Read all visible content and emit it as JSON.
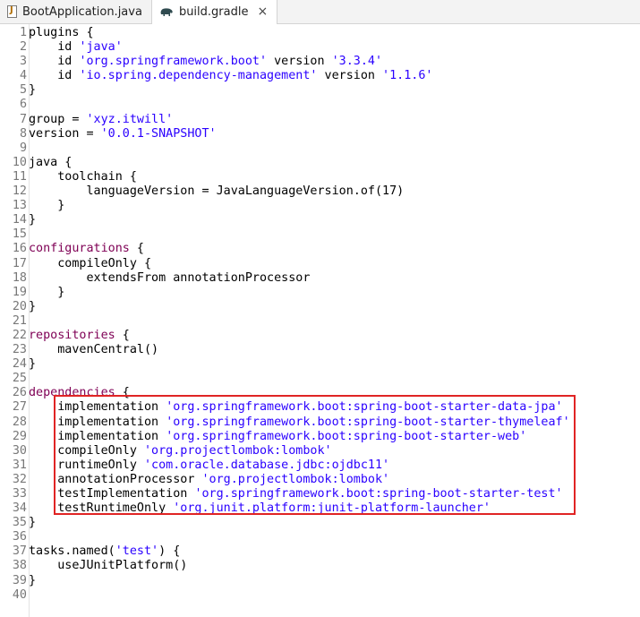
{
  "tabs": [
    {
      "label": "BootApplication.java",
      "icon": "java-file-icon",
      "active": false
    },
    {
      "label": "build.gradle",
      "icon": "gradle-elephant-icon",
      "active": true,
      "close": "×"
    }
  ],
  "lines": [
    {
      "n": "1",
      "segs": [
        {
          "t": "plugins {",
          "c": "kw-partial"
        }
      ]
    },
    {
      "n": "2",
      "segs": [
        {
          "t": "    id "
        },
        {
          "t": "'java'",
          "c": "str"
        }
      ]
    },
    {
      "n": "3",
      "segs": [
        {
          "t": "    id "
        },
        {
          "t": "'org.springframework.boot'",
          "c": "str"
        },
        {
          "t": " version "
        },
        {
          "t": "'3.3.4'",
          "c": "str"
        }
      ]
    },
    {
      "n": "4",
      "segs": [
        {
          "t": "    id "
        },
        {
          "t": "'io.spring.dependency-management'",
          "c": "str"
        },
        {
          "t": " version "
        },
        {
          "t": "'1.1.6'",
          "c": "str"
        }
      ]
    },
    {
      "n": "5",
      "segs": [
        {
          "t": "}"
        }
      ]
    },
    {
      "n": "6",
      "segs": []
    },
    {
      "n": "7",
      "segs": [
        {
          "t": "group = "
        },
        {
          "t": "'xyz.itwill'",
          "c": "str"
        }
      ]
    },
    {
      "n": "8",
      "segs": [
        {
          "t": "version = "
        },
        {
          "t": "'0.0.1-SNAPSHOT'",
          "c": "str"
        }
      ]
    },
    {
      "n": "9",
      "segs": []
    },
    {
      "n": "10",
      "segs": [
        {
          "t": "java {"
        }
      ]
    },
    {
      "n": "11",
      "segs": [
        {
          "t": "    toolchain {"
        }
      ]
    },
    {
      "n": "12",
      "segs": [
        {
          "t": "        languageVersion = JavaLanguageVersion.of(17)"
        }
      ]
    },
    {
      "n": "13",
      "segs": [
        {
          "t": "    }"
        }
      ]
    },
    {
      "n": "14",
      "segs": [
        {
          "t": "}"
        }
      ]
    },
    {
      "n": "15",
      "segs": []
    },
    {
      "n": "16",
      "segs": [
        {
          "t": "configurations",
          "c": "kw"
        },
        {
          "t": " {"
        }
      ]
    },
    {
      "n": "17",
      "segs": [
        {
          "t": "    compileOnly {"
        }
      ]
    },
    {
      "n": "18",
      "segs": [
        {
          "t": "        extendsFrom annotationProcessor"
        }
      ]
    },
    {
      "n": "19",
      "segs": [
        {
          "t": "    }"
        }
      ]
    },
    {
      "n": "20",
      "segs": [
        {
          "t": "}"
        }
      ]
    },
    {
      "n": "21",
      "segs": []
    },
    {
      "n": "22",
      "segs": [
        {
          "t": "repositories",
          "c": "kw"
        },
        {
          "t": " {"
        }
      ]
    },
    {
      "n": "23",
      "segs": [
        {
          "t": "    mavenCentral()"
        }
      ]
    },
    {
      "n": "24",
      "segs": [
        {
          "t": "}"
        }
      ]
    },
    {
      "n": "25",
      "segs": []
    },
    {
      "n": "26",
      "segs": [
        {
          "t": "dependencies",
          "c": "kw"
        },
        {
          "t": " {"
        }
      ]
    },
    {
      "n": "27",
      "segs": [
        {
          "t": "    implementation "
        },
        {
          "t": "'org.springframework.boot:spring-boot-starter-data-jpa'",
          "c": "str"
        }
      ]
    },
    {
      "n": "28",
      "segs": [
        {
          "t": "    implementation "
        },
        {
          "t": "'org.springframework.boot:spring-boot-starter-thymeleaf'",
          "c": "str"
        }
      ]
    },
    {
      "n": "29",
      "segs": [
        {
          "t": "    implementation "
        },
        {
          "t": "'org.springframework.boot:spring-boot-starter-web'",
          "c": "str"
        }
      ]
    },
    {
      "n": "30",
      "segs": [
        {
          "t": "    compileOnly "
        },
        {
          "t": "'org.projectlombok:lombok'",
          "c": "str"
        }
      ]
    },
    {
      "n": "31",
      "segs": [
        {
          "t": "    runtimeOnly "
        },
        {
          "t": "'com.oracle.database.jdbc:ojdbc11'",
          "c": "str"
        }
      ]
    },
    {
      "n": "32",
      "segs": [
        {
          "t": "    annotationProcessor "
        },
        {
          "t": "'org.projectlombok:lombok'",
          "c": "str"
        }
      ]
    },
    {
      "n": "33",
      "segs": [
        {
          "t": "    testImplementation "
        },
        {
          "t": "'org.springframework.boot:spring-boot-starter-test'",
          "c": "str"
        }
      ]
    },
    {
      "n": "34",
      "segs": [
        {
          "t": "    testRuntimeOnly "
        },
        {
          "t": "'org.junit.platform:junit-platform-launcher'",
          "c": "str"
        }
      ]
    },
    {
      "n": "35",
      "segs": [
        {
          "t": "}"
        }
      ]
    },
    {
      "n": "36",
      "segs": []
    },
    {
      "n": "37",
      "segs": [
        {
          "t": "tasks.named("
        },
        {
          "t": "'test'",
          "c": "str"
        },
        {
          "t": ") {"
        }
      ]
    },
    {
      "n": "38",
      "segs": [
        {
          "t": "    useJUnitPlatform()"
        }
      ]
    },
    {
      "n": "39",
      "segs": [
        {
          "t": "}"
        }
      ]
    },
    {
      "n": "40",
      "segs": []
    }
  ],
  "colors": {
    "keyword": "#7f0055",
    "string": "#2a00ff",
    "line_number": "#787878",
    "highlight_border": "#e02424"
  }
}
